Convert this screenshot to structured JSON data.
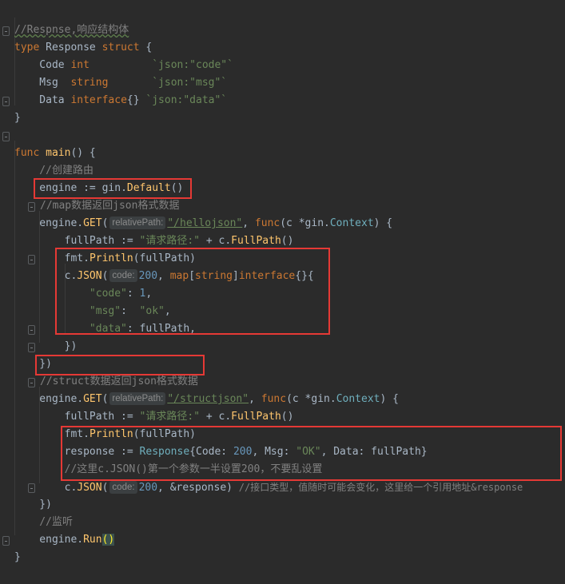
{
  "lines": {
    "l1": "//Respnse,响应结构体",
    "l2_kw": "type",
    "l2_name": " Response ",
    "l2_kw2": "struct",
    "l2_rest": " {",
    "l3_field": "    Code ",
    "l3_type": "int",
    "l3_tag_pad": "          ",
    "l3_tag": "`json:\"code\"`",
    "l4_field": "    Msg  ",
    "l4_type": "string",
    "l4_tag_pad": "       ",
    "l4_tag": "`json:\"msg\"`",
    "l5_field": "    Data ",
    "l5_type": "interface",
    "l5_rest": "{} ",
    "l5_tag": "`json:\"data\"`",
    "l6": "}",
    "l8_kw": "func",
    "l8_fn": " main",
    "l8_rest": "() {",
    "l9": "    //创建路由",
    "l10_a": "    engine := ",
    "l10_pkg": "gin",
    "l10_dot": ".",
    "l10_m": "Default",
    "l10_b": "()",
    "l11": "//map数据返回json格式数据",
    "l12_a": "    engine.",
    "l12_m": "GET",
    "l12_b": "(",
    "l12_hint": "relativePath:",
    "l12_str": "\"/hellojson\"",
    "l12_c": ", ",
    "l12_kw": "func",
    "l12_d": "(c *",
    "l12_pkg": "gin",
    "l12_e": ".",
    "l12_t": "Context",
    "l12_f": ") {",
    "l13_a": "        fullPath := ",
    "l13_str": "\"请求路径:\"",
    "l13_b": " + c.",
    "l13_m": "FullPath",
    "l13_c": "()",
    "l14_a": "        ",
    "l14_pkg": "fmt",
    "l14_dot": ".",
    "l14_m": "Println",
    "l14_b": "(fullPath)",
    "l15_a": "        c.",
    "l15_m": "JSON",
    "l15_b": "(",
    "l15_hint": "code:",
    "l15_num": "200",
    "l15_c": ", ",
    "l15_kw": "map",
    "l15_d": "[",
    "l15_kw2": "string",
    "l15_e": "]",
    "l15_kw3": "interface",
    "l15_f": "{}{",
    "l16_a": "            ",
    "l16_str": "\"code\"",
    "l16_b": ": ",
    "l16_num": "1",
    "l16_c": ",",
    "l17_a": "            ",
    "l17_str": "\"msg\"",
    "l17_b": ":  ",
    "l17_str2": "\"ok\"",
    "l17_c": ",",
    "l18_a": "            ",
    "l18_str": "\"data\"",
    "l18_b": ": fullPath,",
    "l19": "        })",
    "l20": "    })",
    "l21": "//struct数据返回json格式数据",
    "l22_a": "    engine.",
    "l22_m": "GET",
    "l22_b": "(",
    "l22_hint": "relativePath:",
    "l22_str": "\"/structjson\"",
    "l22_c": ", ",
    "l22_kw": "func",
    "l22_d": "(c *",
    "l22_pkg": "gin",
    "l22_e": ".",
    "l22_t": "Context",
    "l22_f": ") {",
    "l23_a": "        fullPath := ",
    "l23_str": "\"请求路径:\"",
    "l23_b": " + c.",
    "l23_m": "FullPath",
    "l23_c": "()",
    "l24_a": "        ",
    "l24_pkg": "fmt",
    "l24_dot": ".",
    "l24_m": "Println",
    "l24_b": "(fullPath)",
    "l25_a": "        response := ",
    "l25_t": "Response",
    "l25_b": "{Code: ",
    "l25_num": "200",
    "l25_c": ", Msg: ",
    "l25_str": "\"OK\"",
    "l25_d": ", Data: fullPath}",
    "l26": "        //这里c.JSON()第一个参数一半设置200，不要乱设置",
    "l27_a": "        c.",
    "l27_m": "JSON",
    "l27_b": "(",
    "l27_hint": "code:",
    "l27_num": "200",
    "l27_c": ", &response) ",
    "l27_cmt": "//接口类型，值随时可能会变化，这里给一个引用地址&response",
    "l28": "    })",
    "l29": "    //监听",
    "l30_a": "    engine.",
    "l30_m": "Run",
    "l30_b": "()",
    "l31": "}"
  },
  "colors": {
    "background": "#2b2b2b",
    "keyword": "#cc7832",
    "function": "#ffc66d",
    "string": "#6a8759",
    "number": "#6897bb",
    "comment": "#808080",
    "highlight_box": "#e53935"
  }
}
